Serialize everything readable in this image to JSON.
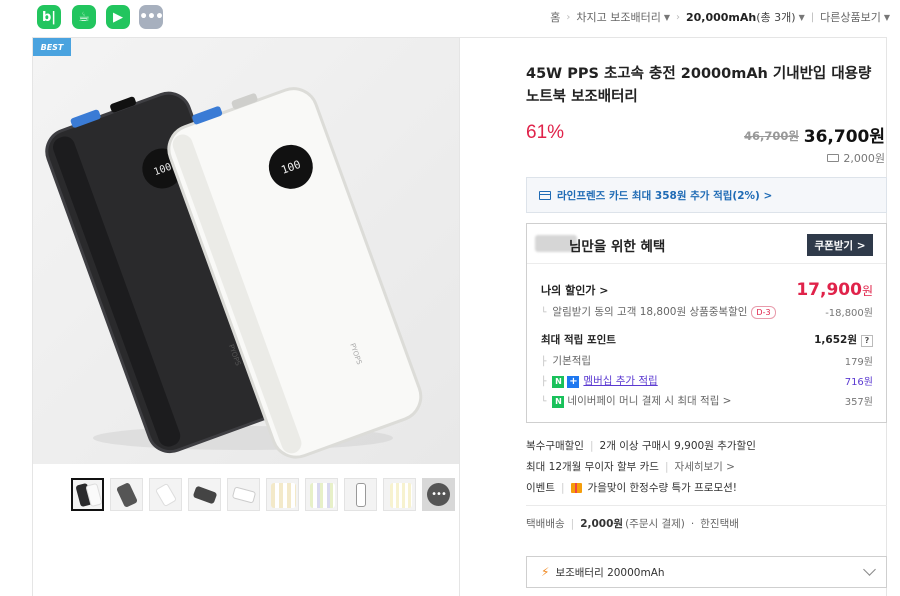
{
  "topbar": {
    "apps": [
      {
        "name": "blog-icon",
        "glyph": "b|"
      },
      {
        "name": "cafe-icon",
        "glyph": "☕"
      },
      {
        "name": "bookmark-icon",
        "glyph": "▶"
      },
      {
        "name": "more-apps-icon",
        "glyph": "•••"
      }
    ],
    "breadcrumb": {
      "home": "홈",
      "category": "차지고 보조배터리",
      "current": "20,000mAh",
      "current_count": "(총 3개)",
      "other": "다른상품보기"
    }
  },
  "gallery": {
    "badge": "BEST",
    "device_display_left": "100",
    "device_display_right": "100",
    "device_brand": "PYOPS",
    "thumb_count": 10,
    "more_label": "•••"
  },
  "product": {
    "title": "45W PPS 초고속 충전 20000mAh 기내반입 대용량 노트북 보조배터리",
    "discount_rate": "61%",
    "original_price": "46,700원",
    "sale_price": "36,700원",
    "shipping_points": "2,000원"
  },
  "card_benefit": {
    "text": "라인프렌즈 카드 최대 358원 추가 적립(2%) >"
  },
  "benefit": {
    "title": "님만을 위한 혜택",
    "coupon_button": "쿠폰받기 >",
    "my_discount_label": "나의 할인가 >",
    "my_discount_value": "17,900",
    "my_discount_unit": "원",
    "alarm_discount_label": "알림받기 동의 고객 18,800원 상품중복할인",
    "alarm_dday": "D-3",
    "alarm_discount_value": "-18,800원",
    "max_points_label": "최대 적립 포인트",
    "max_points_value": "1,652원",
    "help": "?",
    "basic_label": "기본적립",
    "basic_value": "179원",
    "membership_label": "멤버십 추가 적립",
    "membership_value": "716원",
    "npay_label": "네이버페이 머니 결제 시 최대 적립 >",
    "npay_value": "357원"
  },
  "extras": {
    "multi_label": "복수구매할인",
    "multi_value": "2개 이상 구매시 9,900원 추가할인",
    "installment_label": "최대 12개월 무이자 할부 카드",
    "installment_link": "자세히보기 >",
    "event_label": "이벤트",
    "event_value": "가을맞이 한정수량 특가 프로모션!",
    "delivery_label": "택배배송",
    "delivery_fee": "2,000원",
    "delivery_note": "(주문시 결제)",
    "delivery_carrier": "한진택배"
  },
  "option": {
    "selected": "보조배터리 20000mAh"
  },
  "colors": {
    "accent_red": "#e0234a",
    "link_blue": "#1f6bb5",
    "naver_green": "#19c15b"
  }
}
